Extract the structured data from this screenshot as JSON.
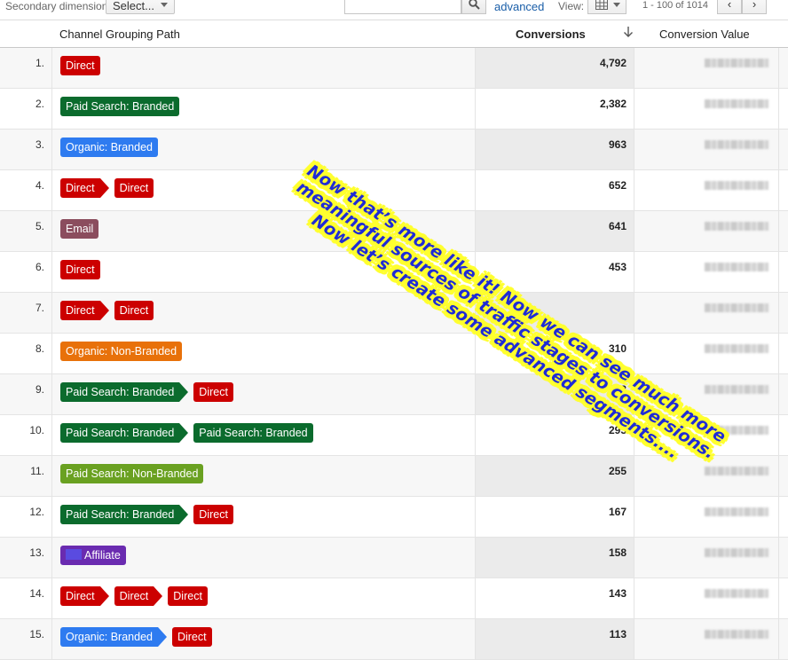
{
  "toolbar": {
    "secondary_dimension_label": "Secondary dimension:",
    "select_value": "Select...",
    "search_value": "",
    "advanced_label": "advanced",
    "view_label": "View:",
    "range_label": "1 - 100 of 1014",
    "prev_label": "‹",
    "next_label": "›"
  },
  "table": {
    "headers": {
      "path": "Channel Grouping Path",
      "conversions": "Conversions",
      "conversion_value": "Conversion Value"
    },
    "rows": [
      {
        "num": "1.",
        "conv": "4,792",
        "path": [
          {
            "label": "Direct",
            "color": "#cc0000"
          }
        ]
      },
      {
        "num": "2.",
        "conv": "2,382",
        "path": [
          {
            "label": "Paid Search: Branded",
            "color": "#0b6b2d"
          }
        ]
      },
      {
        "num": "3.",
        "conv": "963",
        "path": [
          {
            "label": "Organic: Branded",
            "color": "#2e7bf0"
          }
        ]
      },
      {
        "num": "4.",
        "conv": "652",
        "path": [
          {
            "label": "Direct",
            "color": "#cc0000"
          },
          {
            "label": "Direct",
            "color": "#cc0000"
          }
        ]
      },
      {
        "num": "5.",
        "conv": "641",
        "path": [
          {
            "label": "Email",
            "color": "#8b4d5e"
          }
        ]
      },
      {
        "num": "6.",
        "conv": "453",
        "path": [
          {
            "label": "Direct",
            "color": "#cc0000"
          }
        ]
      },
      {
        "num": "7.",
        "conv": "",
        "path": [
          {
            "label": "Direct",
            "color": "#cc0000"
          },
          {
            "label": "Direct",
            "color": "#cc0000"
          }
        ]
      },
      {
        "num": "8.",
        "conv": "310",
        "path": [
          {
            "label": "Organic: Non-Branded",
            "color": "#e8710a"
          }
        ]
      },
      {
        "num": "9.",
        "conv": "303",
        "path": [
          {
            "label": "Paid Search: Branded",
            "color": "#0b6b2d"
          },
          {
            "label": "Direct",
            "color": "#cc0000"
          }
        ]
      },
      {
        "num": "10.",
        "conv": "293",
        "path": [
          {
            "label": "Paid Search: Branded",
            "color": "#0b6b2d"
          },
          {
            "label": "Paid Search: Branded",
            "color": "#0b6b2d"
          }
        ]
      },
      {
        "num": "11.",
        "conv": "255",
        "path": [
          {
            "label": "Paid Search: Non-Branded",
            "color": "#6aa121"
          }
        ]
      },
      {
        "num": "12.",
        "conv": "167",
        "path": [
          {
            "label": "Paid Search: Branded",
            "color": "#0b6b2d"
          },
          {
            "label": "Direct",
            "color": "#cc0000"
          }
        ]
      },
      {
        "num": "13.",
        "conv": "158",
        "path": [
          {
            "label": "Affiliate",
            "color": "#6a2bb0",
            "icon": true
          }
        ]
      },
      {
        "num": "14.",
        "conv": "143",
        "path": [
          {
            "label": "Direct",
            "color": "#cc0000"
          },
          {
            "label": "Direct",
            "color": "#cc0000"
          },
          {
            "label": "Direct",
            "color": "#cc0000"
          }
        ]
      },
      {
        "num": "15.",
        "conv": "113",
        "path": [
          {
            "label": "Organic: Branded",
            "color": "#2e7bf0"
          },
          {
            "label": "Direct",
            "color": "#cc0000"
          }
        ]
      }
    ]
  },
  "callout": {
    "lines": [
      "Now that’s more like it! Now we can see much more",
      "meaningful sources of traffic stages to conversions.",
      "Now let’s create some advanced segments...."
    ],
    "text_color": "#1f2bd6",
    "highlight_color": "#ffff30"
  }
}
